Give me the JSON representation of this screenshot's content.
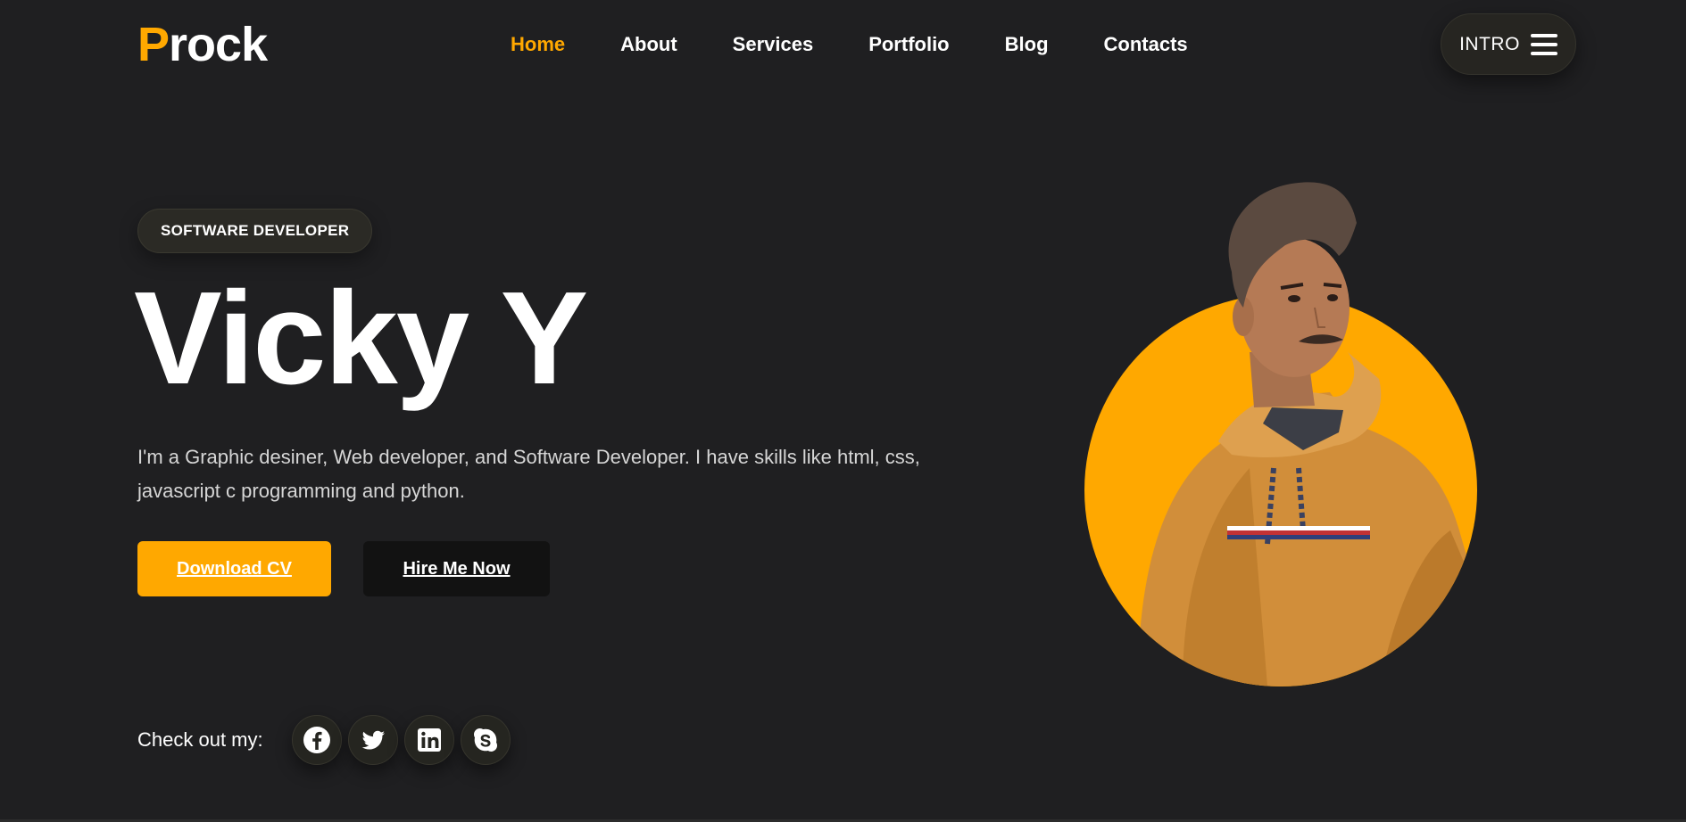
{
  "header": {
    "logo_accent": "P",
    "logo_rest": "rock",
    "nav": [
      {
        "label": "Home",
        "active": true
      },
      {
        "label": "About"
      },
      {
        "label": "Services"
      },
      {
        "label": "Portfolio"
      },
      {
        "label": "Blog"
      },
      {
        "label": "Contacts"
      }
    ],
    "intro_label": "INTRO",
    "menu_icon": "hamburger-icon"
  },
  "hero": {
    "badge": "SOFTWARE DEVELOPER",
    "name": "Vicky Y",
    "description": "I'm a Graphic desiner, Web developer, and Software Developer. I have skills like html, css, javascript c programming and python.",
    "primary_button": "Download CV",
    "secondary_button": "Hire Me Now"
  },
  "social": {
    "label": "Check out my:",
    "icons": [
      "facebook-icon",
      "twitter-icon",
      "linkedin-icon",
      "skype-icon"
    ]
  },
  "colors": {
    "accent": "#ffa800",
    "background": "#1f1f21",
    "dark_button": "#121212"
  }
}
